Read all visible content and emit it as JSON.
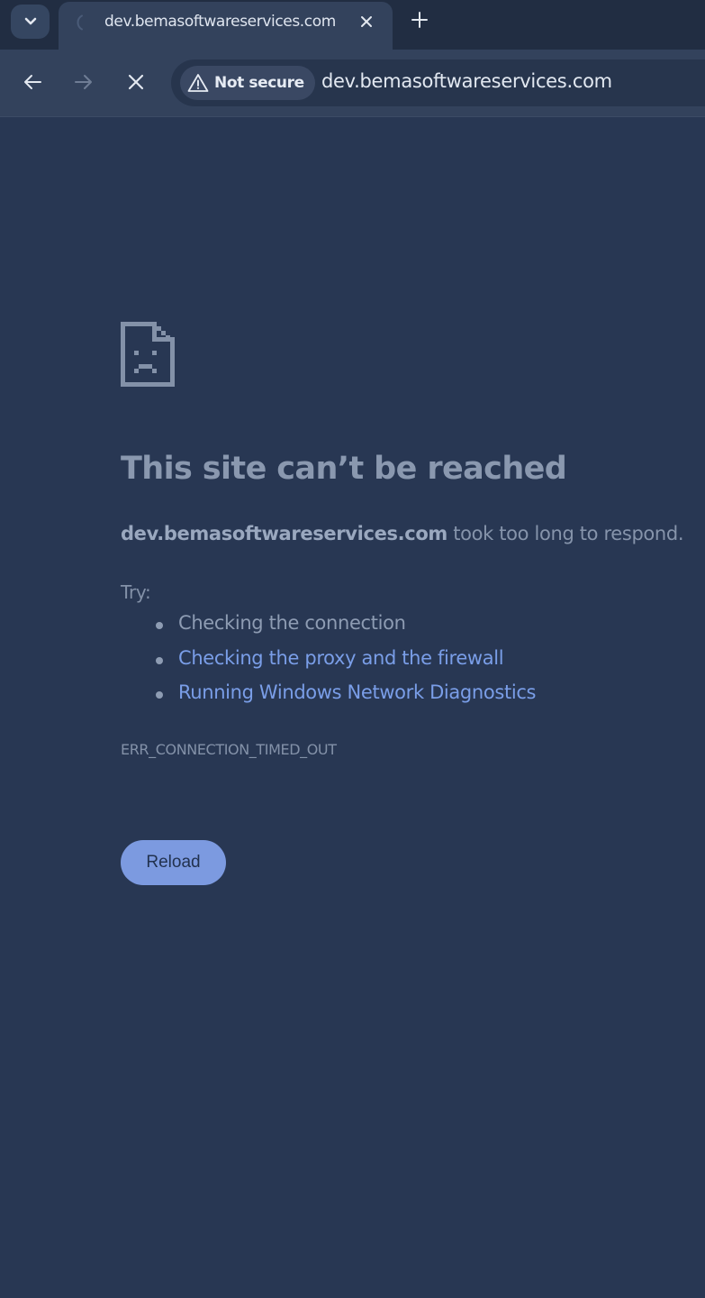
{
  "browser": {
    "tab": {
      "title": "dev.bemasoftwareservices.com",
      "loading": true
    },
    "toolbar": {
      "security_label": "Not secure",
      "url": "dev.bemasoftwareservices.com"
    },
    "icons": {
      "tab_search": "chevron-down-icon",
      "tab_spinner": "loading-spinner-icon",
      "tab_close": "close-icon",
      "new_tab": "plus-icon",
      "back": "arrow-left-icon",
      "forward": "arrow-right-icon",
      "stop": "close-icon",
      "security": "warning-triangle-icon"
    }
  },
  "error_page": {
    "icon": "sad-document-icon",
    "heading": "This site can’t be reached",
    "host": "dev.bemasoftwareservices.com",
    "message": " took too long to respond.",
    "try_label": "Try:",
    "suggestions": [
      {
        "text": "Checking the connection",
        "is_link": false
      },
      {
        "text": "Checking the proxy and the firewall",
        "is_link": true
      },
      {
        "text": "Running Windows Network Diagnostics",
        "is_link": true
      }
    ],
    "error_code": "ERR_CONNECTION_TIMED_OUT",
    "reload_label": "Reload"
  },
  "colors": {
    "page_background": "#283753",
    "toolbar_background": "#33425c",
    "tabstrip_background": "#212d42",
    "link": "#7a9ee8",
    "reload_button": "#7c9ae0"
  }
}
